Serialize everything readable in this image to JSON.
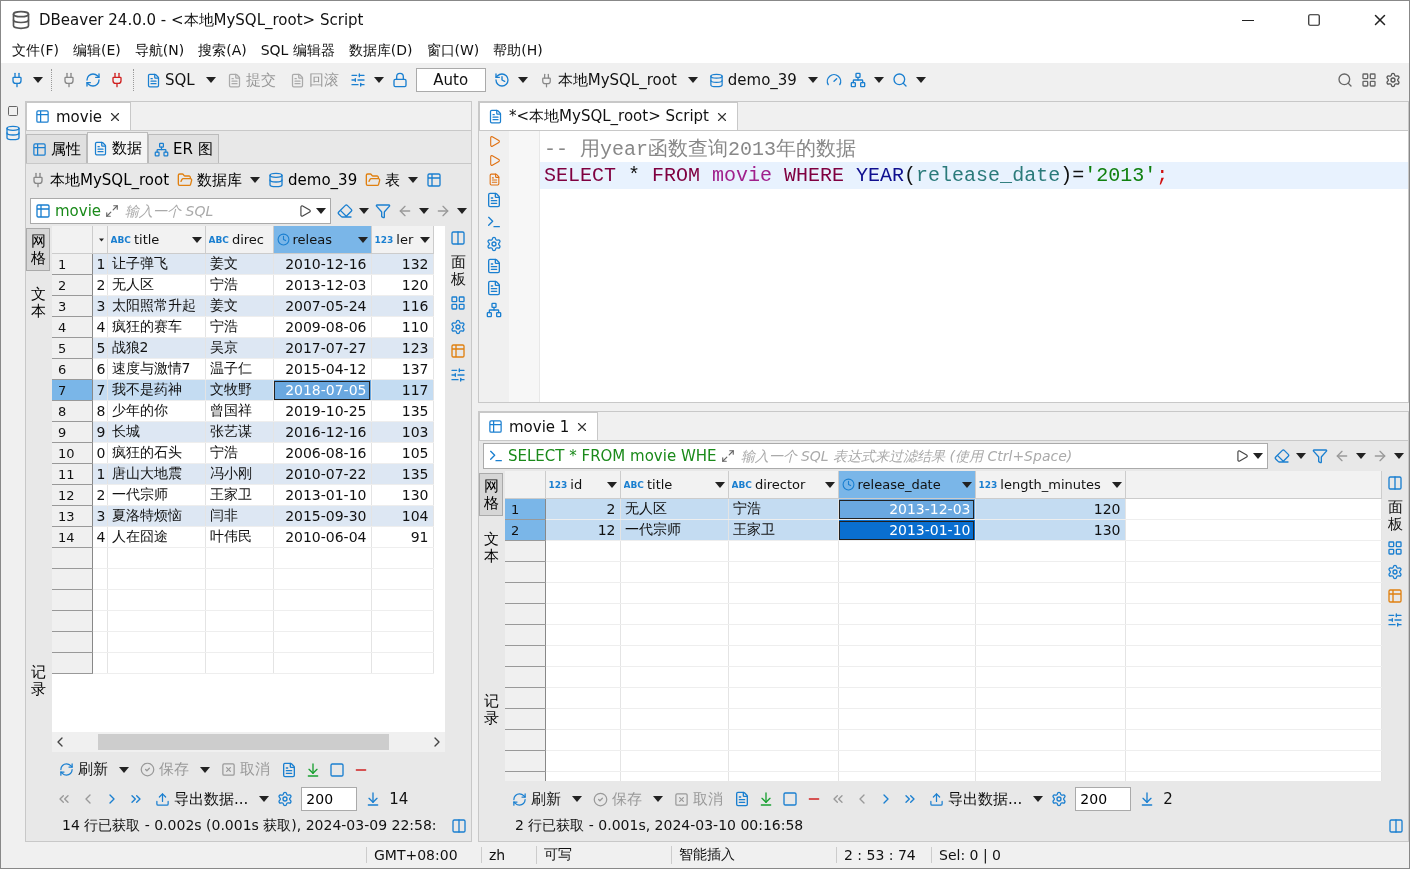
{
  "window": {
    "title": "DBeaver 24.0.0 - <本地MySQL_root> Script"
  },
  "menu": [
    "文件(F)",
    "编辑(E)",
    "导航(N)",
    "搜索(A)",
    "SQL 编辑器",
    "数据库(D)",
    "窗口(W)",
    "帮助(H)"
  ],
  "toolbar": {
    "sql": "SQL",
    "commit": {
      "label": "提交",
      "disabled": true
    },
    "rollback": {
      "label": "回滚",
      "disabled": true
    },
    "mode": "Auto",
    "connection": "本地MySQL_root",
    "database": "demo_39"
  },
  "left_panel": {
    "tab": "movie",
    "subtabs": [
      {
        "label": "属性",
        "selected": false
      },
      {
        "label": "数据",
        "selected": true
      },
      {
        "label": "ER 图",
        "selected": false
      }
    ],
    "breadcrumb": [
      {
        "label": "本地MySQL_root",
        "kind": "connection"
      },
      {
        "label": "数据库",
        "kind": "folder"
      },
      {
        "label": "demo_39",
        "kind": "database"
      },
      {
        "label": "表",
        "kind": "folder"
      }
    ],
    "grid": {
      "source": "movie",
      "placeholder": "输入一个 SQL",
      "side_tabs": [
        {
          "label": "网格",
          "selected": true
        },
        {
          "label": "文本",
          "selected": false
        },
        {
          "label": "记录",
          "selected": false
        }
      ],
      "panels": "面板",
      "columns": [
        {
          "kind": "number",
          "active": false
        },
        {
          "label": "title",
          "kind": "text",
          "tag": "ABC",
          "active": false
        },
        {
          "label": "direc",
          "kind": "text",
          "tag": "ABC",
          "active": false
        },
        {
          "label": "releas",
          "kind": "date",
          "active": true
        },
        {
          "label": "ler",
          "kind": "number",
          "tag": "123",
          "active": false
        }
      ],
      "rows": [
        {
          "num": "1",
          "selected": false,
          "cells": [
            "1",
            "让子弹飞",
            "姜文",
            "2010-12-16",
            "132"
          ]
        },
        {
          "num": "2",
          "selected": false,
          "cells": [
            "2",
            "无人区",
            "宁浩",
            "2013-12-03",
            "120"
          ]
        },
        {
          "num": "3",
          "selected": false,
          "cells": [
            "3",
            "太阳照常升起",
            "姜文",
            "2007-05-24",
            "116"
          ]
        },
        {
          "num": "4",
          "selected": false,
          "cells": [
            "4",
            "疯狂的赛车",
            "宁浩",
            "2009-08-06",
            "110"
          ]
        },
        {
          "num": "5",
          "selected": false,
          "cells": [
            "5",
            "战狼2",
            "吴京",
            "2017-07-27",
            "123"
          ]
        },
        {
          "num": "6",
          "selected": false,
          "cells": [
            "6",
            "速度与激情7",
            "温子仁",
            "2015-04-12",
            "137"
          ]
        },
        {
          "num": "7",
          "selected": true,
          "cells": [
            "7",
            "我不是药神",
            "文牧野",
            "2018-07-05",
            "117"
          ]
        },
        {
          "num": "8",
          "selected": false,
          "cells": [
            "8",
            "少年的你",
            "曾国祥",
            "2019-10-25",
            "135"
          ]
        },
        {
          "num": "9",
          "selected": false,
          "cells": [
            "9",
            "长城",
            "张艺谋",
            "2016-12-16",
            "103"
          ]
        },
        {
          "num": "10",
          "selected": false,
          "cells": [
            "0",
            "疯狂的石头",
            "宁浩",
            "2006-08-16",
            "105"
          ]
        },
        {
          "num": "11",
          "selected": false,
          "cells": [
            "1",
            "唐山大地震",
            "冯小刚",
            "2010-07-22",
            "135"
          ]
        },
        {
          "num": "12",
          "selected": false,
          "cells": [
            "2",
            "一代宗师",
            "王家卫",
            "2013-01-10",
            "130"
          ]
        },
        {
          "num": "13",
          "selected": false,
          "cells": [
            "3",
            "夏洛特烦恼",
            "闫非",
            "2015-09-30",
            "104"
          ]
        },
        {
          "num": "14",
          "selected": false,
          "cells": [
            "4",
            "人在囧途",
            "叶伟民",
            "2010-06-04",
            "91"
          ]
        }
      ],
      "refresh": "刷新",
      "save": {
        "label": "保存",
        "disabled": true
      },
      "cancel": {
        "label": "取消",
        "disabled": true
      },
      "export": "导出数据...",
      "fetch_size": "200",
      "row_count": "14",
      "status": "14 行已获取 - 0.002s (0.001s 获取), 2024-03-09 22:58:"
    }
  },
  "editor": {
    "tab": "*<本地MySQL_root> Script",
    "lines": [
      {
        "current": false,
        "tokens": [
          {
            "kind": "comment",
            "text": "-- 用year函数查询2013年的数据"
          }
        ]
      },
      {
        "current": true,
        "tokens": [
          {
            "kind": "keyword",
            "text": "SELECT"
          },
          {
            "kind": "plain",
            "text": " * "
          },
          {
            "kind": "keyword",
            "text": "FROM "
          },
          {
            "kind": "table",
            "text": "movie "
          },
          {
            "kind": "keyword",
            "text": "WHERE "
          },
          {
            "kind": "function",
            "text": "YEAR"
          },
          {
            "kind": "plain",
            "text": "("
          },
          {
            "kind": "column",
            "text": "release_date"
          },
          {
            "kind": "plain",
            "text": ")="
          },
          {
            "kind": "string",
            "text": "'2013'"
          },
          {
            "kind": "semicolon",
            "text": ";"
          }
        ]
      }
    ]
  },
  "results": {
    "tab": "movie 1",
    "grid": {
      "source": "SELECT * FROM movie WHE",
      "placeholder": "输入一个 SQL 表达式来过滤结果 (使用 Ctrl+Space)",
      "side_tabs": [
        {
          "label": "网格",
          "selected": true
        },
        {
          "label": "文本",
          "selected": false
        },
        {
          "label": "记录",
          "selected": false
        }
      ],
      "panels": "面板",
      "columns": [
        {
          "label": "id",
          "kind": "number",
          "tag": "123",
          "active": false
        },
        {
          "label": "title",
          "kind": "text",
          "tag": "ABC",
          "active": false
        },
        {
          "label": "director",
          "kind": "text",
          "tag": "ABC",
          "active": false
        },
        {
          "label": "release_date",
          "kind": "date",
          "active": true
        },
        {
          "label": "length_minutes",
          "kind": "number",
          "tag": "123",
          "active": false
        }
      ],
      "rows": [
        {
          "num": "1",
          "selected": true,
          "cells": [
            "2",
            "无人区",
            "宁浩",
            "2013-12-03",
            "120"
          ]
        },
        {
          "num": "2",
          "selected": true,
          "cells": [
            "12",
            "一代宗师",
            "王家卫",
            "2013-01-10",
            "130"
          ]
        }
      ],
      "refresh": "刷新",
      "save": {
        "label": "保存",
        "disabled": true
      },
      "cancel": {
        "label": "取消",
        "disabled": true
      },
      "export": "导出数据...",
      "fetch_size": "200",
      "row_count": "2",
      "status": "2 行已获取 - 0.001s, 2024-03-10 00:16:58"
    }
  },
  "status_bar": [
    "GMT+08:00",
    "zh",
    "可写",
    "智能插入",
    "2 : 53 : 74",
    "Sel: 0 | 0"
  ]
}
